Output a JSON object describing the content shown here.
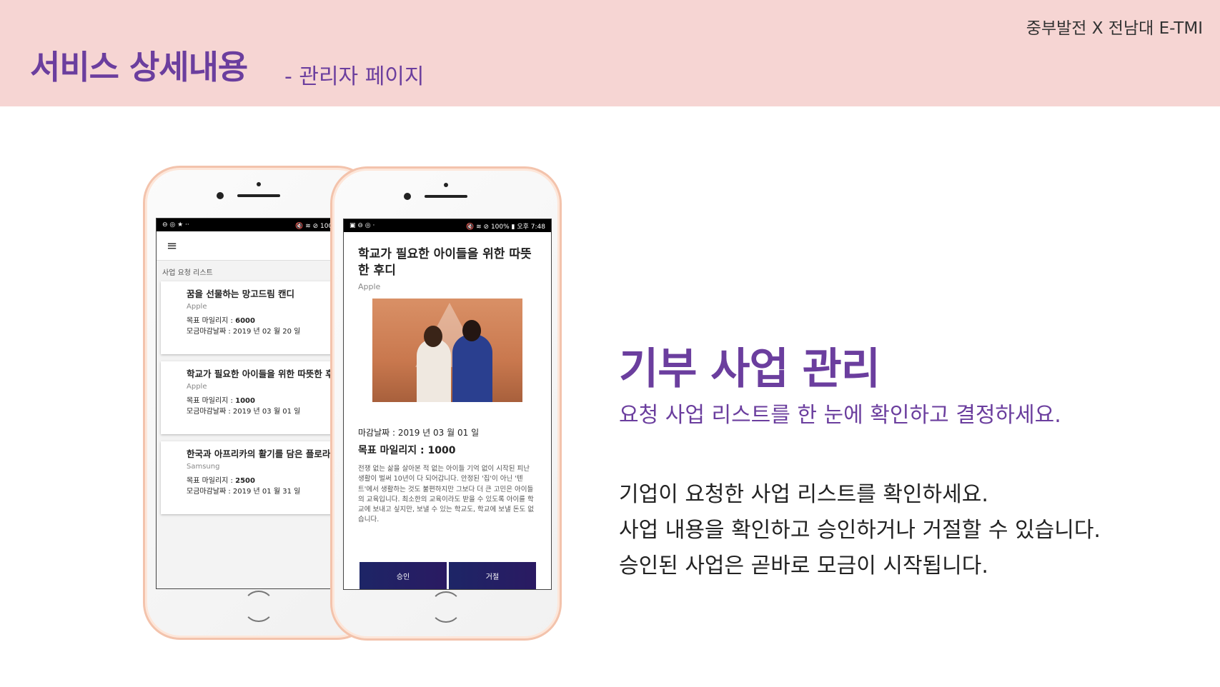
{
  "header": {
    "title": "서비스 상세내용",
    "subtitle": "- 관리자 페이지",
    "partner": "중부발전  X  전남대 E-TMI"
  },
  "phone_left": {
    "status_left": "⊖ ◎ ★ ··",
    "status_right": "🔇 ≋ ⊘ 100% ▮ 오후",
    "menu_icon": "≡",
    "list_label": "사업 요청 리스트",
    "cards": [
      {
        "title": "꿈을 선물하는 망고드림 캔디",
        "brand": "Apple",
        "goal_label": "목표 마일리지 : ",
        "goal": "6000",
        "deadline": "모금마감날짜 : 2019 년 02 월 20 일"
      },
      {
        "title": "학교가 필요한 아이들을 위한 따뜻한 후디",
        "brand": "Apple",
        "goal_label": "목표 마일리지 : ",
        "goal": "1000",
        "deadline": "모금마감날짜 : 2019 년 03 월 01 일"
      },
      {
        "title": "한국과 아프리카의 활기를 담은 플로라백",
        "brand": "Samsung",
        "goal_label": "목표 마일리지 : ",
        "goal": "2500",
        "deadline": "모금마감날짜 : 2019 년 01 월 31 일"
      }
    ]
  },
  "phone_right": {
    "status_left": "▣ ⊖ ◎ ·",
    "status_right": "🔇 ≋ ⊘ 100% ▮ 오후 7:48",
    "title": "학교가 필요한 아이들을 위한 따뜻한 후디",
    "brand": "Apple",
    "deadline": "마감날짜 : 2019 년 03 월 01 일",
    "goal": "목표 마일리지 : 1000",
    "body": "전쟁 없는 삶을 살아본 적 없는 아이들 기억 없이 시작된 피난 생활이 벌써 10년이 다 되어갑니다. 안정된 '집'이 아닌 '텐트'에서 생활하는 것도 불편하지만 그보다 더 큰 고민은 아이들의 교육입니다. 최소한의 교육이라도 받을 수 있도록 아이를 학교에 보내고 싶지만, 보낼 수 있는 학교도, 학교에 보낼 돈도 없습니다.",
    "approve": "승인",
    "reject": "거절"
  },
  "side": {
    "title": "기부 사업 관리",
    "subtitle": "요청 사업 리스트를 한 눈에 확인하고 결정하세요.",
    "lines": [
      "기업이 요청한 사업 리스트를  확인하세요.",
      "사업 내용을 확인하고 승인하거나 거절할 수 있습니다.",
      "승인된 사업은 곧바로 모금이 시작됩니다."
    ]
  }
}
